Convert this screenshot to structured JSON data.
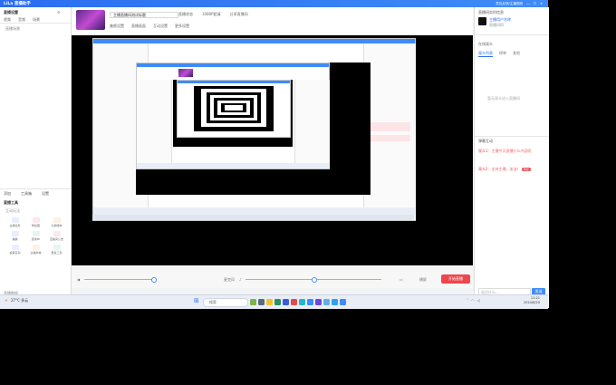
{
  "title_bar": {
    "brand": "LiLa 直播助手",
    "right_label": "意见反馈/主播规则"
  },
  "left_panel": {
    "section_title": "直播设置",
    "tabs": [
      "视频",
      "音频",
      "场景"
    ],
    "scene_label": "直播场景",
    "source_actions": [
      "添加",
      "工具箱",
      "设置"
    ],
    "tools_title": "直播工具",
    "tools_subtitle": "互动玩法",
    "tools": [
      {
        "label": "主播任务"
      },
      {
        "label": "粉丝团"
      },
      {
        "label": "礼物特效"
      },
      {
        "label": "福袋"
      },
      {
        "label": "连线PK"
      },
      {
        "label": "直播间公告"
      },
      {
        "label": "投票互动"
      },
      {
        "label": "主播商城"
      },
      {
        "label": "更多工具"
      }
    ],
    "bottom_label": "直播数据"
  },
  "header": {
    "stream_title": "主播直播间测试标题",
    "line1_items": [
      "直播状态",
      "1080P超清",
      "分享直播间"
    ],
    "line2_items": [
      "美颜设置",
      "直播画面",
      "互动设置",
      "更多设置"
    ]
  },
  "controls": {
    "volume_label": "麦克风",
    "mode_label": "横屏",
    "start_label": "开始直播"
  },
  "right_panel": {
    "header": "直播间实时信息",
    "user_title": "主播用户名称",
    "user_sub": "直播间ID",
    "stats_label": "在线观众",
    "tabs": [
      "观众列表",
      "榜单",
      "其他"
    ],
    "empty_text": "暂无观众进入直播间",
    "chat_header": "弹幕互动",
    "chat": [
      {
        "user": "观众1",
        "text": "主播今天直播什么内容呢"
      },
      {
        "user": "观众2",
        "text": "支持主播，加油！",
        "tag": "粉丝"
      }
    ],
    "input_placeholder": "说点什么...",
    "send_label": "发送"
  },
  "taskbar": {
    "weather": "27°C 多云",
    "search_placeholder": "搜索",
    "time": "11:21",
    "date": "2024/6/20"
  },
  "colors": {
    "accent": "#2b6df0",
    "live_red": "#f0464b"
  }
}
